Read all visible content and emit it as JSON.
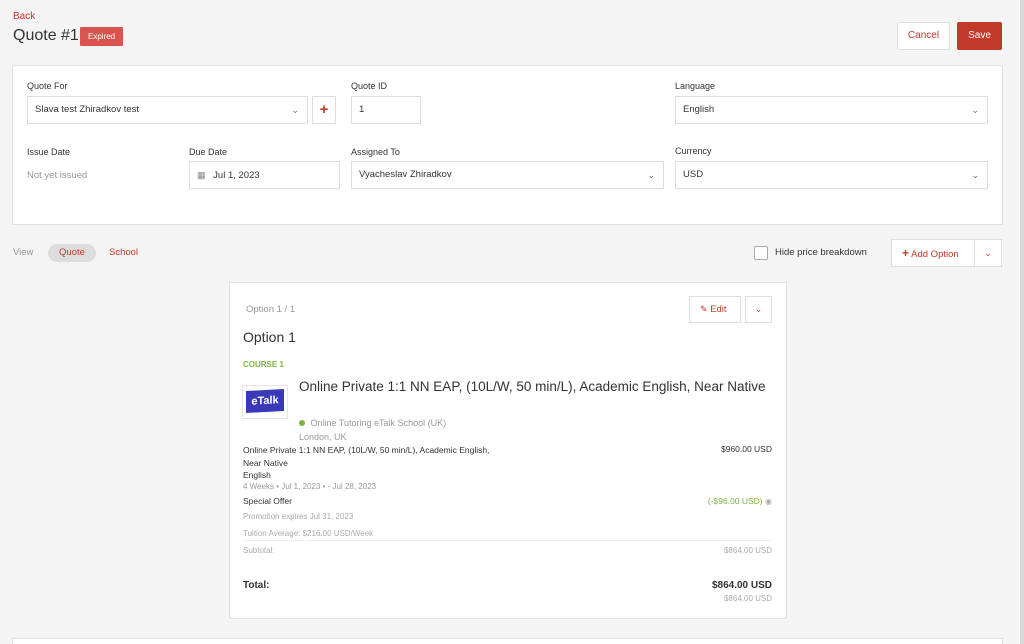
{
  "header": {
    "back_label": "Back",
    "title": "Quote #1",
    "status_badge": "Expired",
    "cancel_label": "Cancel",
    "save_label": "Save"
  },
  "form": {
    "quote_for": {
      "label": "Quote For",
      "value": "Slava test Zhiradkov test"
    },
    "quote_id": {
      "label": "Quote ID",
      "value": "1"
    },
    "language": {
      "label": "Language",
      "value": "English"
    },
    "issue_date": {
      "label": "Issue Date",
      "value": "Not yet issued"
    },
    "due_date": {
      "label": "Due Date",
      "value": "Jul 1, 2023"
    },
    "assigned_to": {
      "label": "Assigned To",
      "value": "Vyacheslav Zhiradkov"
    },
    "currency": {
      "label": "Currency",
      "value": "USD"
    }
  },
  "view_bar": {
    "view_label": "View",
    "tab_quote": "Quote",
    "tab_school": "School",
    "hide_price_label": "Hide price breakdown",
    "add_option_label": "Add Option"
  },
  "option_card": {
    "counter": "Option 1 / 1",
    "edit_label": "Edit",
    "title": "Option 1",
    "course_tag": "COURSE 1",
    "logo_text": "eTalk",
    "course_name": "Online Private 1:1 NN EAP, (10L/W, 50 min/L), Academic English, Near Native",
    "school_name": "Online Tutoring eTalk School (UK)",
    "school_location": "London, UK",
    "line_item_name_1": "Online Private 1:1 NN EAP, (10L/W, 50 min/L), Academic English,",
    "line_item_name_2": "Near Native",
    "line_item_name_3": "English",
    "line_item_price": "$960.00 USD",
    "line_item_meta": "4 Weeks  •  Jul 1, 2023  •  - Jul 28, 2023",
    "offer_label": "Special Offer",
    "offer_value": "(-$96.00 USD)",
    "promo_expiry": "Promotion expires Jul 31, 2023",
    "tuition_avg": "Tuition Average: $216.00 USD/Week",
    "subtotal_label": "Subtotal:",
    "subtotal_value": "$864.00 USD",
    "total_label": "Total:",
    "total_value": "$864.00 USD",
    "total_sub_value": "$864.00 USD"
  },
  "colors": {
    "accent": "#c0392b",
    "badge": "#d9534f",
    "green": "#7cb342",
    "logo_bg": "#3a3ab8"
  }
}
